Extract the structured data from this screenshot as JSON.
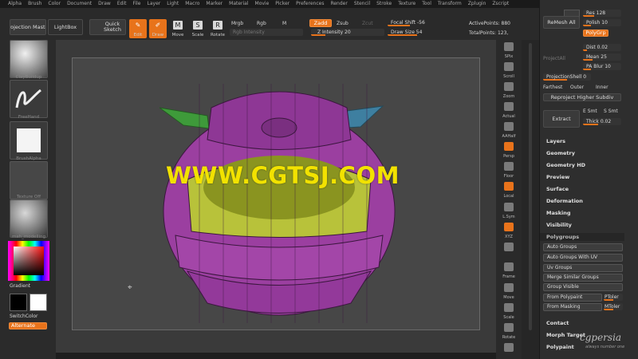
{
  "menu": [
    "Alpha",
    "Brush",
    "Color",
    "Document",
    "Draw",
    "Edit",
    "File",
    "Layer",
    "Light",
    "Macro",
    "Marker",
    "Material",
    "Movie",
    "Picker",
    "Preferences",
    "Render",
    "Stencil",
    "Stroke",
    "Texture",
    "Tool",
    "Transform",
    "Zplugin",
    "Zscript"
  ],
  "shelf": {
    "projection_master": "Projection Master",
    "lightbox": "LightBox",
    "quick_sketch": "Quick Sketch",
    "edit": "Edit",
    "draw": "Draw",
    "move": "Move",
    "scale": "Scale",
    "rotate": "Rotate",
    "mrgb": "Mrgb",
    "rgb": "Rgb",
    "m": "M",
    "rgb_intensity": "Rgb Intensity",
    "zadd": "Zadd",
    "zsub": "Zsub",
    "zcut": "Zcut",
    "z_intensity": "Z Intensity 20",
    "focal_shift": "Focal Shift -56",
    "draw_size": "Draw Size 54",
    "active_points": "ActivePoints: 880",
    "total_points": "TotalPoints: 123,"
  },
  "left": {
    "brush_caption": "ClayBuildup",
    "stroke_caption": "FreeHand",
    "alpha_caption": "BrushAlpha",
    "texture_caption": "Texture Off",
    "material_caption": "mah_modelling",
    "gradient": "Gradient",
    "switchcolor": "SwitchColor",
    "alternate": "Alternate"
  },
  "viewport": {
    "watermark": "WWW.CGTSJ.COM"
  },
  "righttools": [
    "SPix",
    "Scroll",
    "Zoom",
    "Actual",
    "AAHalf",
    "Persp",
    "Floor",
    "Local",
    "L.Sym",
    "XYZ",
    "",
    "Frame",
    "Move",
    "Scale",
    "Rotate",
    ""
  ],
  "toolpanel": {
    "remesh_all": "ReMesh All",
    "res": "Res 128",
    "polish": "Polish 10",
    "polygrp": "PolyGrp",
    "project_all": "ProjectAll",
    "dist": "Dist 0.02",
    "mean": "Mean 25",
    "pa_blur": "PA Blur 10",
    "projection_shell": "ProjectionShell 0",
    "farthest": "Farthest",
    "outer": "Outer",
    "inner": "Inner",
    "reproject": "Reproject Higher Subdiv",
    "extract": "Extract",
    "e_smt": "E Smt",
    "s_smt": "S Smt",
    "thick": "Thick 0.02",
    "menus": [
      "Layers",
      "Geometry",
      "Geometry HD",
      "Preview",
      "Surface",
      "Deformation",
      "Masking",
      "Visibility"
    ],
    "polygroups": "Polygroups",
    "pg_buttons": [
      "Auto Groups",
      "Auto Groups With UV",
      "Uv Groups",
      "Merge Similar Groups",
      "Group Visible"
    ],
    "from_polypaint": "From Polypaint",
    "ptoler": "PToler",
    "from_masking": "From Masking",
    "mtoler": "MToler",
    "menus2": [
      "Contact",
      "Morph Target",
      "Polypaint"
    ],
    "logo": "cgpersia",
    "logo_sub": "always number one"
  },
  "colors": {
    "accent": "#e8731b",
    "watermark": "#f2e200",
    "mesh": "#9b3fa0"
  }
}
